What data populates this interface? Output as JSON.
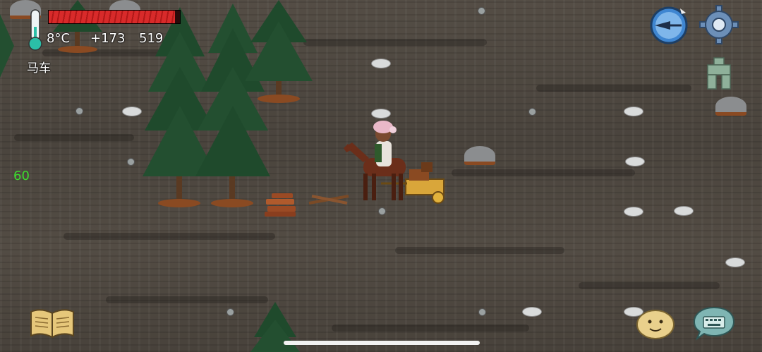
{
  "hud": {
    "temperature": "8°C",
    "yum_bonus": "+173",
    "score": "519",
    "held_item": "马车",
    "fps": "60",
    "health_fraction": 0.96
  },
  "colors": {
    "health_bar": "#d82a2a",
    "fps_text": "#3ddc2e",
    "tree_green": "#1f4a2c",
    "ground": "#4d4740",
    "compass_blue": "#3f86d1"
  },
  "icons": {
    "thermometer": "thermometer-icon",
    "compass": "compass-icon",
    "settings": "gear-icon",
    "family": "family-tree-icon",
    "recipe_book": "book-icon",
    "emote": "potato-face-icon",
    "chat": "keyboard-chat-icon"
  }
}
